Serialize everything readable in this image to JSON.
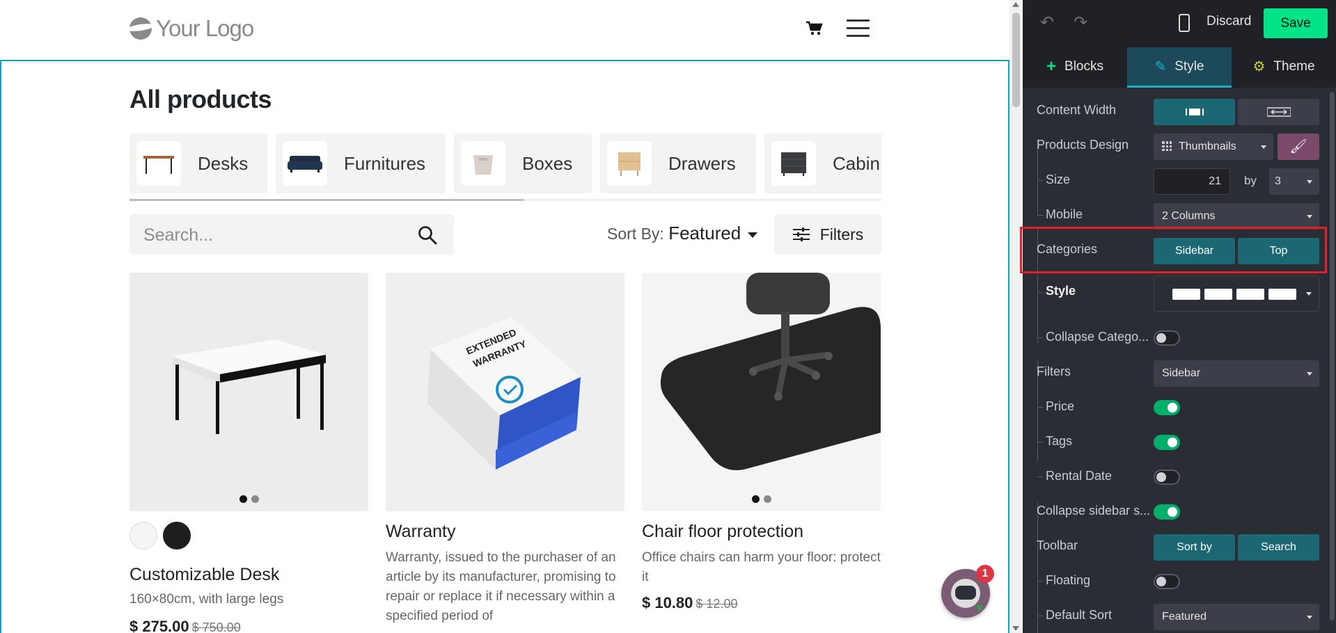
{
  "site": {
    "logo_text": "Your Logo",
    "page_title": "All products",
    "categories": [
      {
        "label": "Desks"
      },
      {
        "label": "Furnitures"
      },
      {
        "label": "Boxes"
      },
      {
        "label": "Drawers"
      },
      {
        "label": "Cabin"
      }
    ],
    "search_placeholder": "Search...",
    "sort_label": "Sort By:",
    "sort_value": "Featured",
    "filters_label": "Filters",
    "products": [
      {
        "name": "Customizable Desk",
        "description": "160×80cm, with large legs",
        "price": "$ 275.00",
        "old_price": "$ 750.00"
      },
      {
        "name": "Warranty",
        "description": "Warranty, issued to the purchaser of an article by its manufacturer, promising to repair or replace it if necessary within a specified period of",
        "box_text_1": "EXTENDED",
        "box_text_2": "WARRANTY"
      },
      {
        "name": "Chair floor protection",
        "description": "Office chairs can harm your floor: protect it",
        "price": "$ 10.80",
        "old_price": "$ 12.00"
      }
    ],
    "chatbot_badge": "1"
  },
  "editor": {
    "discard_label": "Discard",
    "save_label": "Save",
    "tabs": [
      {
        "label": "Blocks"
      },
      {
        "label": "Style"
      },
      {
        "label": "Theme"
      }
    ],
    "options": {
      "content_width": "Content Width",
      "products_design": "Products Design",
      "products_design_value": "Thumbnails",
      "size": "Size",
      "size_value": "21",
      "by": "by",
      "columns_value": "3",
      "mobile": "Mobile",
      "mobile_value": "2 Columns",
      "categories": "Categories",
      "categories_sidebar": "Sidebar",
      "categories_top": "Top",
      "style": "Style",
      "collapse_categories": "Collapse Catego...",
      "filters": "Filters",
      "filters_value": "Sidebar",
      "price": "Price",
      "tags": "Tags",
      "rental_date": "Rental Date",
      "collapse_sidebar": "Collapse sidebar s...",
      "toolbar": "Toolbar",
      "toolbar_sort": "Sort by",
      "toolbar_search": "Search",
      "floating": "Floating",
      "default_sort": "Default Sort",
      "default_sort_value": "Featured"
    }
  },
  "colors": {
    "accent": "#17a2b8",
    "save_green": "#00e386",
    "highlight_red": "#e0202a",
    "editor_bg": "#2b2d35",
    "active_seg": "#1b6874"
  }
}
